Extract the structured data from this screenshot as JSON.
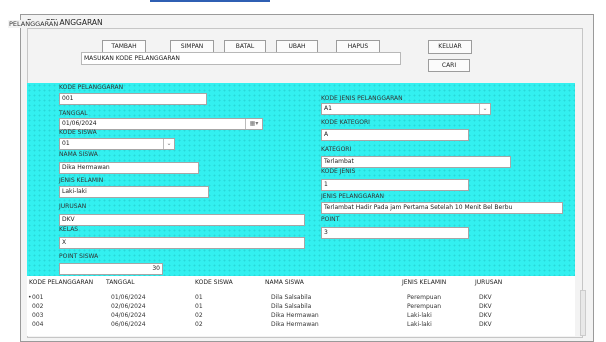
{
  "window": {
    "title": "FormPELANGGARAN"
  },
  "group": {
    "label": "PELANGGARAN"
  },
  "toolbar": {
    "tambah": "TAMBAH",
    "simpan": "SIMPAN",
    "batal": "BATAL",
    "ubah": "UBAH",
    "hapus": "HAPUS",
    "keluar": "KELUAR",
    "cari": "CARI"
  },
  "search": {
    "value": "MASUKAN KODE PELANGGARAN"
  },
  "form": {
    "kode_pelanggaran": {
      "label": "KODE PELANGGARAN",
      "value": "001"
    },
    "tanggal": {
      "label": "TANGGAL",
      "value": "01/06/2024",
      "icon": "calendar-icon"
    },
    "kode_siswa": {
      "label": "KODE SISWA",
      "value": "01"
    },
    "nama_siswa": {
      "label": "NAMA SISWA",
      "value": "Dika Hermawan"
    },
    "jenis_kelamin": {
      "label": "JENIS KELAMIN",
      "value": "Laki-laki"
    },
    "jurusan": {
      "label": "JURUSAN",
      "value": "DKV"
    },
    "kelas": {
      "label": "KELAS",
      "value": "X"
    },
    "point_siswa": {
      "label": "POINT SISWA",
      "value": "30"
    },
    "kode_jenis_pelanggaran": {
      "label": "KODE JENIS PELANGGARAN",
      "value": "A1"
    },
    "kode_kategori": {
      "label": "KODE KATEGORI",
      "value": "A"
    },
    "kategori": {
      "label": "KATEGORI",
      "value": "Terlambat"
    },
    "kode_jenis": {
      "label": "KODE JENIS",
      "value": "1"
    },
    "jenis_pelanggaran": {
      "label": "JENIS PELANGGARAN",
      "value": "Terlambat Hadir Pada jam Pertama Setelah 10 Menit Bel Berbu"
    },
    "point": {
      "label": "POINT",
      "value": "3"
    }
  },
  "table": {
    "columns": [
      "KODE PELANGGARAN",
      "TANGGAL",
      "KODE SISWA",
      "NAMA SISWA",
      "JENIS KELAMIN",
      "JURUSAN"
    ],
    "rows": [
      [
        "001",
        "01/06/2024",
        "01",
        "Dila Salsabila",
        "Perempuan",
        "DKV"
      ],
      [
        "002",
        "02/06/2024",
        "01",
        "Dila Salsabila",
        "Perempuan",
        "DKV"
      ],
      [
        "003",
        "04/06/2024",
        "02",
        "Dika Hermawan",
        "Laki-laki",
        "DKV"
      ],
      [
        "004",
        "06/06/2024",
        "02",
        "Dika Hermawan",
        "Laki-laki",
        "DKV"
      ]
    ],
    "current_row_marker": "•"
  },
  "colors": {
    "panel": "#33f0f0",
    "window": "#f3f3f3",
    "accent": "#2f5fb3"
  }
}
